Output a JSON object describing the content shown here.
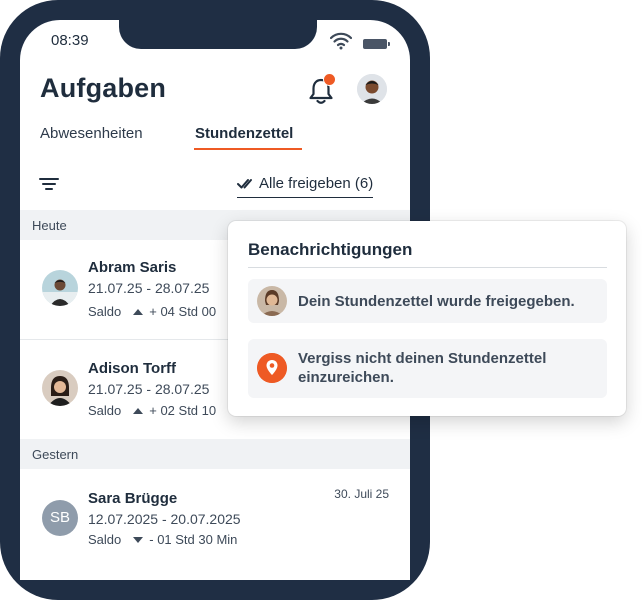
{
  "status_bar": {
    "time": "08:39"
  },
  "header": {
    "title": "Aufgaben"
  },
  "tabs": [
    {
      "label": "Abwesenheiten",
      "active": false
    },
    {
      "label": "Stundenzettel",
      "active": true
    }
  ],
  "toolbar": {
    "approve_all_label": "Alle freigeben (6)"
  },
  "sections": [
    {
      "label": "Heute",
      "items": [
        {
          "name": "Abram Saris",
          "dates": "21.07.25 - 28.07.25",
          "saldo_label": "Saldo",
          "saldo_direction": "up",
          "saldo_value": "+ 04 Std 00"
        },
        {
          "name": "Adison Torff",
          "dates": "21.07.25 - 28.07.25",
          "saldo_label": "Saldo",
          "saldo_direction": "up",
          "saldo_value": "+ 02 Std 10"
        }
      ]
    },
    {
      "label": "Gestern",
      "items": [
        {
          "name": "Sara Brügge",
          "initials": "SB",
          "timestamp": "30. Juli 25",
          "dates": "12.07.2025 - 20.07.2025",
          "saldo_label": "Saldo",
          "saldo_direction": "down",
          "saldo_value": "- 01 Std 30 Min"
        }
      ]
    }
  ],
  "notifications": {
    "title": "Benachrichtigungen",
    "items": [
      {
        "text": "Dein Stundenzettel wurde freigegeben.",
        "icon": "user-avatar"
      },
      {
        "text_line1": "Vergiss nicht deinen Stundenzettel",
        "text_line2": "einzureichen.",
        "icon": "reminder-pin-icon"
      }
    ]
  },
  "colors": {
    "accent": "#ee5a24",
    "navy": "#1f2e44",
    "section_bg": "#f0f2f4"
  }
}
